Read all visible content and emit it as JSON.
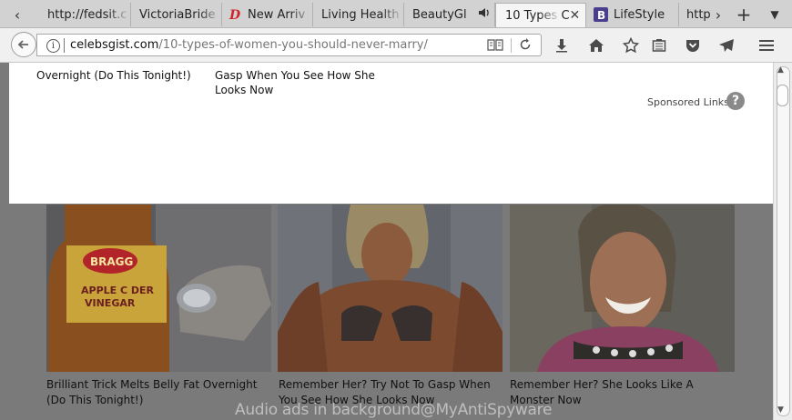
{
  "tabs": [
    {
      "label": "http://fedsit.c",
      "icon": "none"
    },
    {
      "label": "VictoriaBride",
      "icon": "none"
    },
    {
      "label": "New Arriv",
      "icon": "brand-d-icon"
    },
    {
      "label": "Living Health",
      "icon": "none"
    },
    {
      "label": "BeautyGl",
      "icon": "speaker-icon"
    },
    {
      "label": "10 Types C",
      "icon": "none",
      "active": true
    },
    {
      "label": "LifeStyle",
      "icon": "b-logo-icon"
    },
    {
      "label": "http",
      "icon": "none"
    }
  ],
  "address": {
    "domain": "celebsgist.com",
    "path": "/10-types-of-women-you-should-never-marry/"
  },
  "top_ads": [
    {
      "lines": [
        "Overnight (Do This Tonight!)"
      ]
    },
    {
      "lines": [
        "Gasp When You See How She",
        "Looks Now"
      ]
    }
  ],
  "sponsored_label": "Sponsored Links",
  "help_label": "?",
  "tiles": [
    {
      "caption_lines": [
        "Brilliant Trick Melts Belly Fat Overnight",
        "(Do This Tonight!)"
      ],
      "image": "vinegar-bottle"
    },
    {
      "caption_lines": [
        "Remember Her? Try Not To Gasp When",
        "You See How She Looks Now"
      ],
      "image": "bodybuilder"
    },
    {
      "caption_lines": [
        "Remember Her? She Looks Like A",
        "Monster Now"
      ],
      "image": "woman-portrait"
    }
  ],
  "watermark": "Audio ads in background@MyAntiSpyware",
  "colors": {
    "overlay": "#7a7a7a",
    "tab_bg": "#d2d2d2",
    "active_tab": "#f5f5f5",
    "brand_d": "#d0232b",
    "brand_b": "#4a3f8c"
  }
}
